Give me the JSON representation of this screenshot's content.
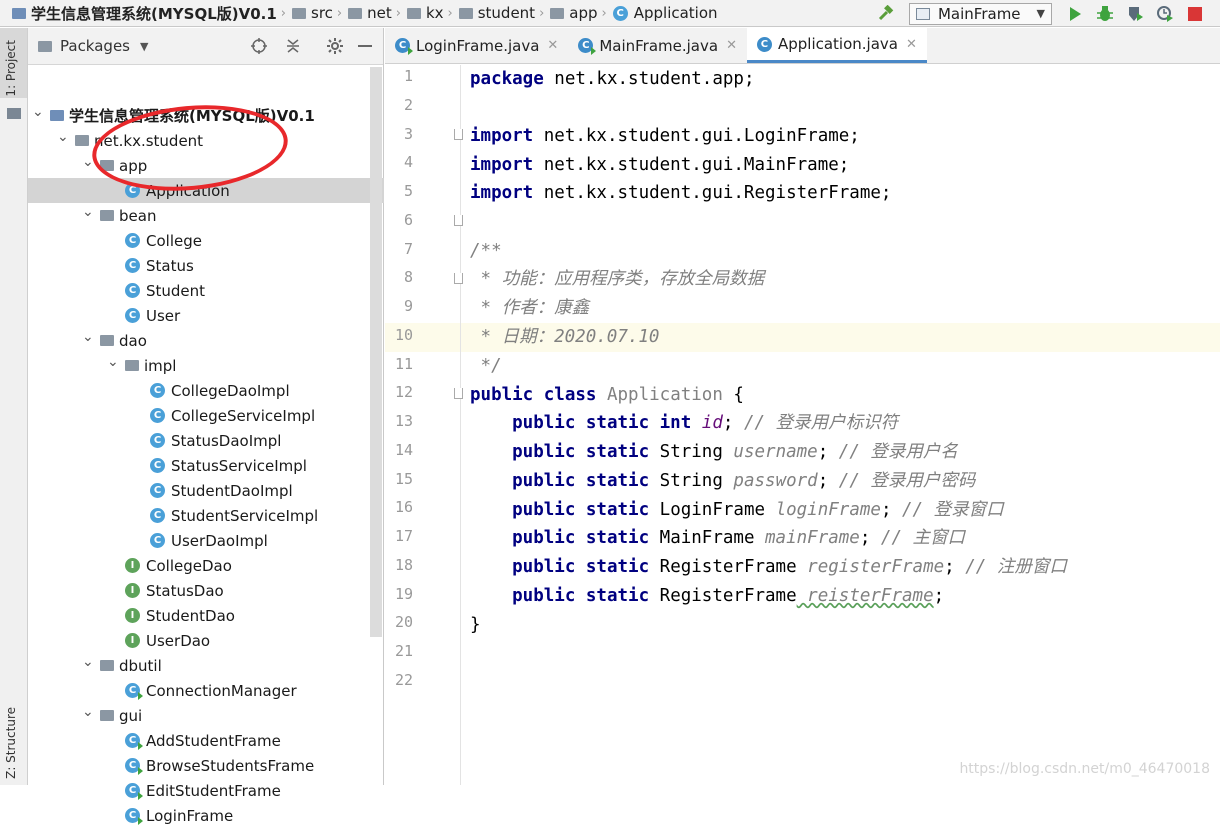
{
  "breadcrumb": [
    "学生信息管理系统(MYSQL版)V0.1",
    "src",
    "net",
    "kx",
    "student",
    "app",
    "Application"
  ],
  "run_config": "MainFrame",
  "left_strip": {
    "project_tab": "1: Project",
    "structure_tab": "Z: Structure"
  },
  "project_panel": {
    "title": "Packages"
  },
  "tree": [
    {
      "label": "学生信息管理系统(MYSQL版)V0.1",
      "depth": 0,
      "icon": "project-folder",
      "expanded": true
    },
    {
      "label": "net.kx.student",
      "depth": 1,
      "icon": "package",
      "expanded": true
    },
    {
      "label": "app",
      "depth": 2,
      "icon": "package",
      "expanded": true
    },
    {
      "label": "Application",
      "depth": 3,
      "icon": "class",
      "selected": true
    },
    {
      "label": "bean",
      "depth": 2,
      "icon": "package",
      "expanded": true
    },
    {
      "label": "College",
      "depth": 3,
      "icon": "class"
    },
    {
      "label": "Status",
      "depth": 3,
      "icon": "class"
    },
    {
      "label": "Student",
      "depth": 3,
      "icon": "class"
    },
    {
      "label": "User",
      "depth": 3,
      "icon": "class"
    },
    {
      "label": "dao",
      "depth": 2,
      "icon": "package",
      "expanded": true
    },
    {
      "label": "impl",
      "depth": 3,
      "icon": "package",
      "expanded": true
    },
    {
      "label": "CollegeDaoImpl",
      "depth": 4,
      "icon": "class"
    },
    {
      "label": "CollegeServiceImpl",
      "depth": 4,
      "icon": "class"
    },
    {
      "label": "StatusDaoImpl",
      "depth": 4,
      "icon": "class"
    },
    {
      "label": "StatusServiceImpl",
      "depth": 4,
      "icon": "class"
    },
    {
      "label": "StudentDaoImpl",
      "depth": 4,
      "icon": "class"
    },
    {
      "label": "StudentServiceImpl",
      "depth": 4,
      "icon": "class"
    },
    {
      "label": "UserDaoImpl",
      "depth": 4,
      "icon": "class"
    },
    {
      "label": "CollegeDao",
      "depth": 3,
      "icon": "interface"
    },
    {
      "label": "StatusDao",
      "depth": 3,
      "icon": "interface"
    },
    {
      "label": "StudentDao",
      "depth": 3,
      "icon": "interface"
    },
    {
      "label": "UserDao",
      "depth": 3,
      "icon": "interface"
    },
    {
      "label": "dbutil",
      "depth": 2,
      "icon": "package",
      "expanded": true
    },
    {
      "label": "ConnectionManager",
      "depth": 3,
      "icon": "class-runnable"
    },
    {
      "label": "gui",
      "depth": 2,
      "icon": "package",
      "expanded": true
    },
    {
      "label": "AddStudentFrame",
      "depth": 3,
      "icon": "class-runnable"
    },
    {
      "label": "BrowseStudentsFrame",
      "depth": 3,
      "icon": "class-runnable"
    },
    {
      "label": "EditStudentFrame",
      "depth": 3,
      "icon": "class-runnable"
    },
    {
      "label": "LoginFrame",
      "depth": 3,
      "icon": "class-runnable"
    }
  ],
  "editor_tabs": [
    {
      "label": "LoginFrame.java",
      "active": false
    },
    {
      "label": "MainFrame.java",
      "active": false
    },
    {
      "label": "Application.java",
      "active": true
    }
  ],
  "line_numbers": [
    "1",
    "2",
    "3",
    "4",
    "5",
    "6",
    "7",
    "8",
    "9",
    "10",
    "11",
    "12",
    "13",
    "14",
    "15",
    "16",
    "17",
    "18",
    "19",
    "20",
    "21",
    "22"
  ],
  "current_line": "10",
  "code": {
    "l1_kw": "package",
    "l1_rest": " net.kx.student.app;",
    "l3_kw": "import",
    "l3_rest": " net.kx.student.gui.LoginFrame;",
    "l4_kw": "import",
    "l4_rest": " net.kx.student.gui.MainFrame;",
    "l5_kw": "import",
    "l5_rest": " net.kx.student.gui.RegisterFrame;",
    "l7": "/**",
    "l8": " * 功能：应用程序类，存放全局数据",
    "l9": " * 作者：康鑫",
    "l10": " * 日期：2020.07.10",
    "l11": " */",
    "l12_kw": "public class",
    "l12_name": " Application",
    "l12_rest": " {",
    "l13_kw": "    public static int",
    "l13_var": " id",
    "l13_semi": ";",
    "l13_cm": " // 登录用户标识符",
    "l14_kw": "    public static",
    "l14_type": " String",
    "l14_var": " username",
    "l14_semi": ";",
    "l14_cm": " // 登录用户名",
    "l15_kw": "    public static",
    "l15_type": " String",
    "l15_var": " password",
    "l15_semi": ";",
    "l15_cm": " // 登录用户密码",
    "l16_kw": "    public static",
    "l16_type": " LoginFrame",
    "l16_var": " loginFrame",
    "l16_semi": ";",
    "l16_cm": " // 登录窗口",
    "l17_kw": "    public static",
    "l17_type": " MainFrame",
    "l17_var": " mainFrame",
    "l17_semi": ";",
    "l17_cm": " // 主窗口",
    "l18_kw": "    public static",
    "l18_type": " RegisterFrame",
    "l18_var": " registerFrame",
    "l18_semi": ";",
    "l18_cm": " // 注册窗口",
    "l19_kw": "    public static",
    "l19_type": " RegisterFrame",
    "l19_var": " reisterFrame",
    "l19_semi": ";",
    "l20": "}"
  },
  "watermark": "https://blog.csdn.net/m0_46470018",
  "colors": {
    "keyword": "#000080",
    "comment": "#808080",
    "static_field": "#660e7a",
    "annotation_circle": "#e8282b",
    "selection": "#d4d4d4",
    "current_line": "#fdfbea"
  }
}
